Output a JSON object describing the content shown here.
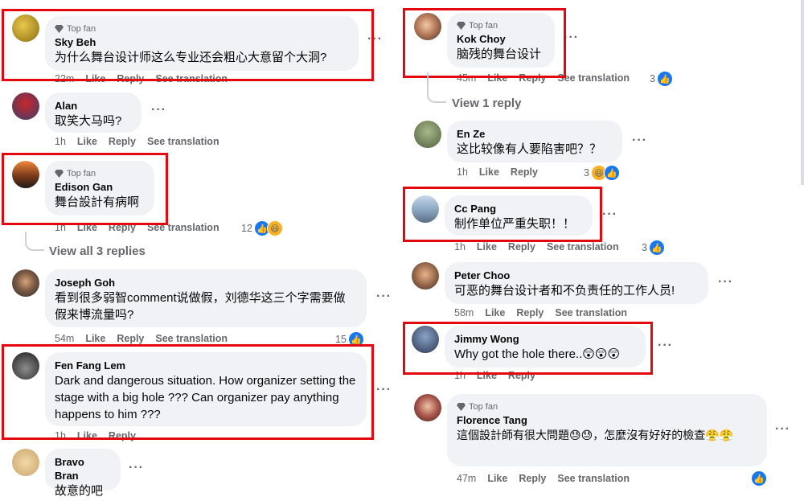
{
  "colors": {
    "highlight": "#e3090f",
    "like": "#1877f2",
    "bubble": "#f0f2f5",
    "meta": "#65676b"
  },
  "icons": {
    "badge": "diamond-icon",
    "more": "more-options-icon",
    "like": "like-reaction-icon",
    "haha": "haha-reaction-icon"
  },
  "labels": {
    "like": "Like",
    "reply": "Reply",
    "see_translation": "See translation"
  },
  "comments": {
    "sky": {
      "badge": "Top fan",
      "name": "Sky Beh",
      "text": "为什么舞台设计师这么专业还会粗心大意留个大洞?",
      "time": "22m"
    },
    "alan": {
      "name": "Alan",
      "text": "取笑大马吗?",
      "time": "1h"
    },
    "edison": {
      "badge": "Top fan",
      "name": "Edison Gan",
      "text": "舞台設計有病啊",
      "time": "1h",
      "reactions": "12",
      "view_replies": "View all 3 replies"
    },
    "joseph": {
      "name": "Joseph Goh",
      "text": "看到很多弱智comment说做假，刘德华这三个字需要做假来博流量吗?",
      "time": "54m",
      "reactions": "15"
    },
    "fen": {
      "name": "Fen Fang Lem",
      "text": "Dark and dangerous situation. How organizer setting the stage with a big hole ??? Can organizer pay anything happens to him ???",
      "time": "1h"
    },
    "bravo": {
      "name": "Bravo Bran",
      "text": "故意的吧"
    },
    "kok": {
      "badge": "Top fan",
      "name": "Kok Choy",
      "text": "脑残的舞台设计",
      "time": "45m",
      "reactions": "3",
      "view_replies": "View 1 reply"
    },
    "enze": {
      "name": "En Ze",
      "text": "这比较像有人要陷害吧？？",
      "time": "1h",
      "reactions": "3"
    },
    "cc": {
      "name": "Cc Pang",
      "text": "制作单位严重失职！！",
      "time": "1h",
      "reactions": "3"
    },
    "peter": {
      "name": "Peter Choo",
      "text": "可恶的舞台设计者和不负责任的工作人员!",
      "time": "58m"
    },
    "jimmy": {
      "name": "Jimmy Wong",
      "text": "Why got the hole there..",
      "time": "1h"
    },
    "florence": {
      "badge": "Top fan",
      "name": "Florence Tang",
      "text": "這個設計師有很大問題😓😓，怎麼沒有好好的檢查😤😤",
      "time": "47m"
    }
  }
}
